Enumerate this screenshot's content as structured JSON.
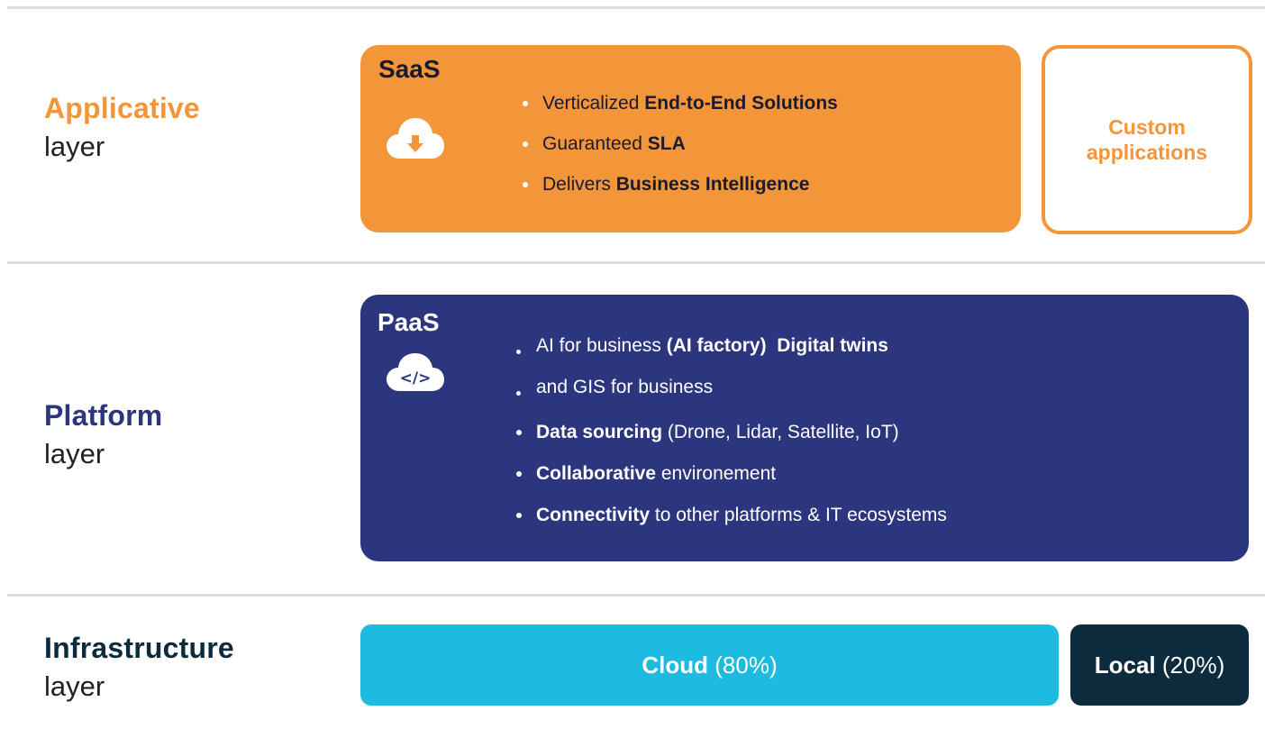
{
  "colors": {
    "orange": "#f39639",
    "navy": "#2b367f",
    "cyan": "#1dbbe0",
    "dark": "#0c2c3e",
    "divider": "#dcdcdc"
  },
  "layers": {
    "applicative": {
      "title": "Applicative",
      "subtitle": "layer"
    },
    "platform": {
      "title": "Platform",
      "subtitle": "layer"
    },
    "infrastructure": {
      "title": "Infrastructure",
      "subtitle": "layer"
    }
  },
  "saas": {
    "title": "SaaS",
    "icon": "cloud-download-icon",
    "bullets": [
      {
        "plain": "Verticalized ",
        "bold": "End-to-End Solutions",
        "rest": ""
      },
      {
        "plain": "Guaranteed ",
        "bold": "SLA",
        "rest": ""
      },
      {
        "plain": "Delivers ",
        "bold": "Business Intelligence",
        "rest": ""
      }
    ]
  },
  "custom": {
    "line1": "Custom",
    "line2": "applications"
  },
  "paas": {
    "title": "PaaS",
    "icon": "cloud-code-icon",
    "code_glyph": "</>",
    "bullets": [
      {
        "plain": "AI for business ",
        "bold": "(AI factory)  Digital twins",
        "rest": ""
      },
      {
        "plain": "and GIS for business",
        "bold": "",
        "rest": ""
      },
      {
        "plain": "",
        "bold": "Data sourcing",
        "rest": " (Drone, Lidar, Satellite, IoT)"
      },
      {
        "plain": "",
        "bold": "Collaborative",
        "rest": " environement"
      },
      {
        "plain": "",
        "bold": "Connectivity",
        "rest": " to other platforms & IT ecosystems"
      }
    ]
  },
  "infra": {
    "cloud": {
      "label": "Cloud",
      "share": "(80%)"
    },
    "local": {
      "label": "Local",
      "share": "(20%)"
    }
  }
}
